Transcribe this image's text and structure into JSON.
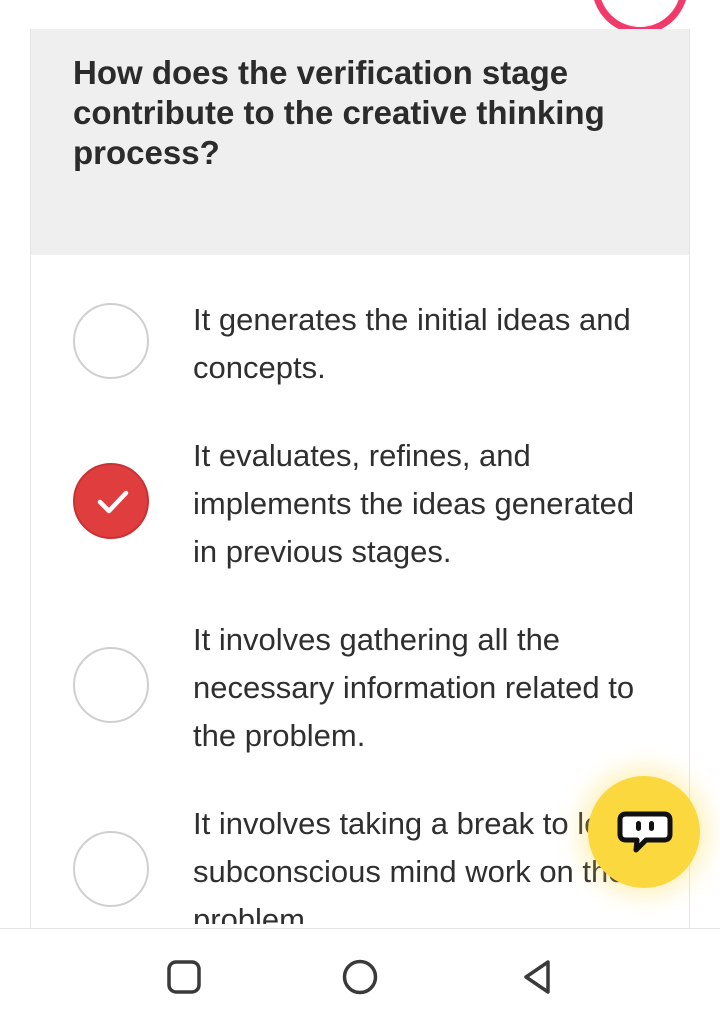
{
  "question": {
    "text": "How does the verification stage contribute to the creative thinking process?"
  },
  "options": [
    {
      "text": "It generates the initial ideas and concepts.",
      "selected": false
    },
    {
      "text": "It evaluates, refines, and implements the ideas generated in previous stages.",
      "selected": true
    },
    {
      "text": "It involves gathering all the necessary information related to the problem.",
      "selected": false
    },
    {
      "text": "It involves taking a break to let the subconscious mind work on the problem.",
      "selected": false
    }
  ],
  "colors": {
    "accent_ring": "#f23a6a",
    "selected_radio": "#e03d3f",
    "chat_fab": "#fcd83f",
    "question_bg": "#efefef"
  },
  "icons": {
    "checkmark": "check-icon",
    "chat": "chat-bubble-icon",
    "nav_recents": "square-icon",
    "nav_home": "circle-icon",
    "nav_back": "triangle-back-icon"
  }
}
